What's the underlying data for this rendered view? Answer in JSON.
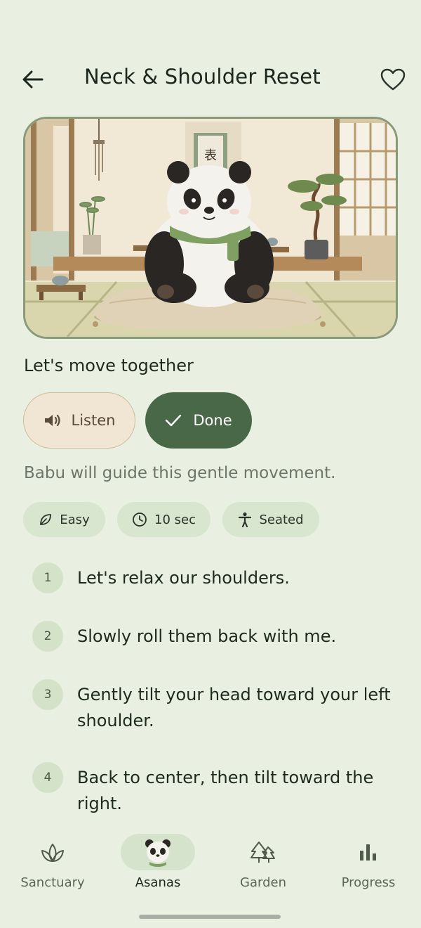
{
  "header": {
    "title": "Neck & Shoulder Reset",
    "back_icon": "arrow-left-icon",
    "favorite_icon": "heart-outline-icon"
  },
  "hero": {
    "illustration": "panda-meditating-on-cushion"
  },
  "section": {
    "title": "Let's move together"
  },
  "actions": {
    "listen_label": "Listen",
    "listen_icon": "speaker-icon",
    "done_label": "Done",
    "done_icon": "check-icon"
  },
  "subtitle": "Babu will guide this gentle movement.",
  "chips": [
    {
      "label": "Easy",
      "icon": "leaf-icon"
    },
    {
      "label": "10 sec",
      "icon": "clock-icon"
    },
    {
      "label": "Seated",
      "icon": "person-seated-icon"
    }
  ],
  "steps": [
    {
      "num": "1",
      "text": "Let's relax our shoulders."
    },
    {
      "num": "2",
      "text": "Slowly roll them back with me."
    },
    {
      "num": "3",
      "text": "Gently tilt your head toward your left shoulder."
    },
    {
      "num": "4",
      "text": "Back to center, then tilt toward the right."
    }
  ],
  "nav": {
    "items": [
      {
        "label": "Sanctuary",
        "icon": "lotus-icon",
        "active": false
      },
      {
        "label": "Asanas",
        "icon": "panda-avatar-icon",
        "active": true
      },
      {
        "label": "Garden",
        "icon": "trees-icon",
        "active": false
      },
      {
        "label": "Progress",
        "icon": "bar-chart-icon",
        "active": false
      }
    ]
  },
  "colors": {
    "background": "#e9f0e1",
    "primary": "#486848",
    "chip_bg": "#d8e5cf",
    "listen_bg": "#f1e6d4"
  }
}
